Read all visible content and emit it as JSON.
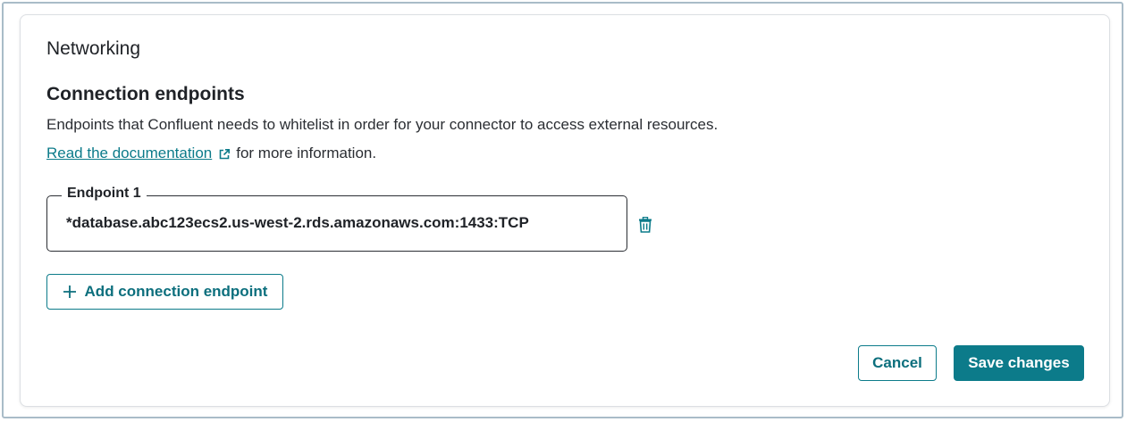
{
  "card": {
    "section_title": "Networking",
    "subsection_title": "Connection endpoints",
    "description": "Endpoints that Confluent needs to whitelist in order for your connector to access external resources.",
    "docs_link_text": "Read the documentation",
    "docs_suffix": "for more information."
  },
  "endpoints": [
    {
      "label": "Endpoint 1",
      "value": "*database.abc123ecs2.us-west-2.rds.amazonaws.com:1433:TCP"
    }
  ],
  "buttons": {
    "add_endpoint": "Add connection endpoint",
    "cancel": "Cancel",
    "save": "Save changes"
  },
  "icons": {
    "external": "external-link-icon",
    "delete": "trash-icon",
    "add": "plus-icon"
  },
  "colors": {
    "accent": "#0c7b8a",
    "text": "#1f2227",
    "border": "#dcdfe3"
  }
}
